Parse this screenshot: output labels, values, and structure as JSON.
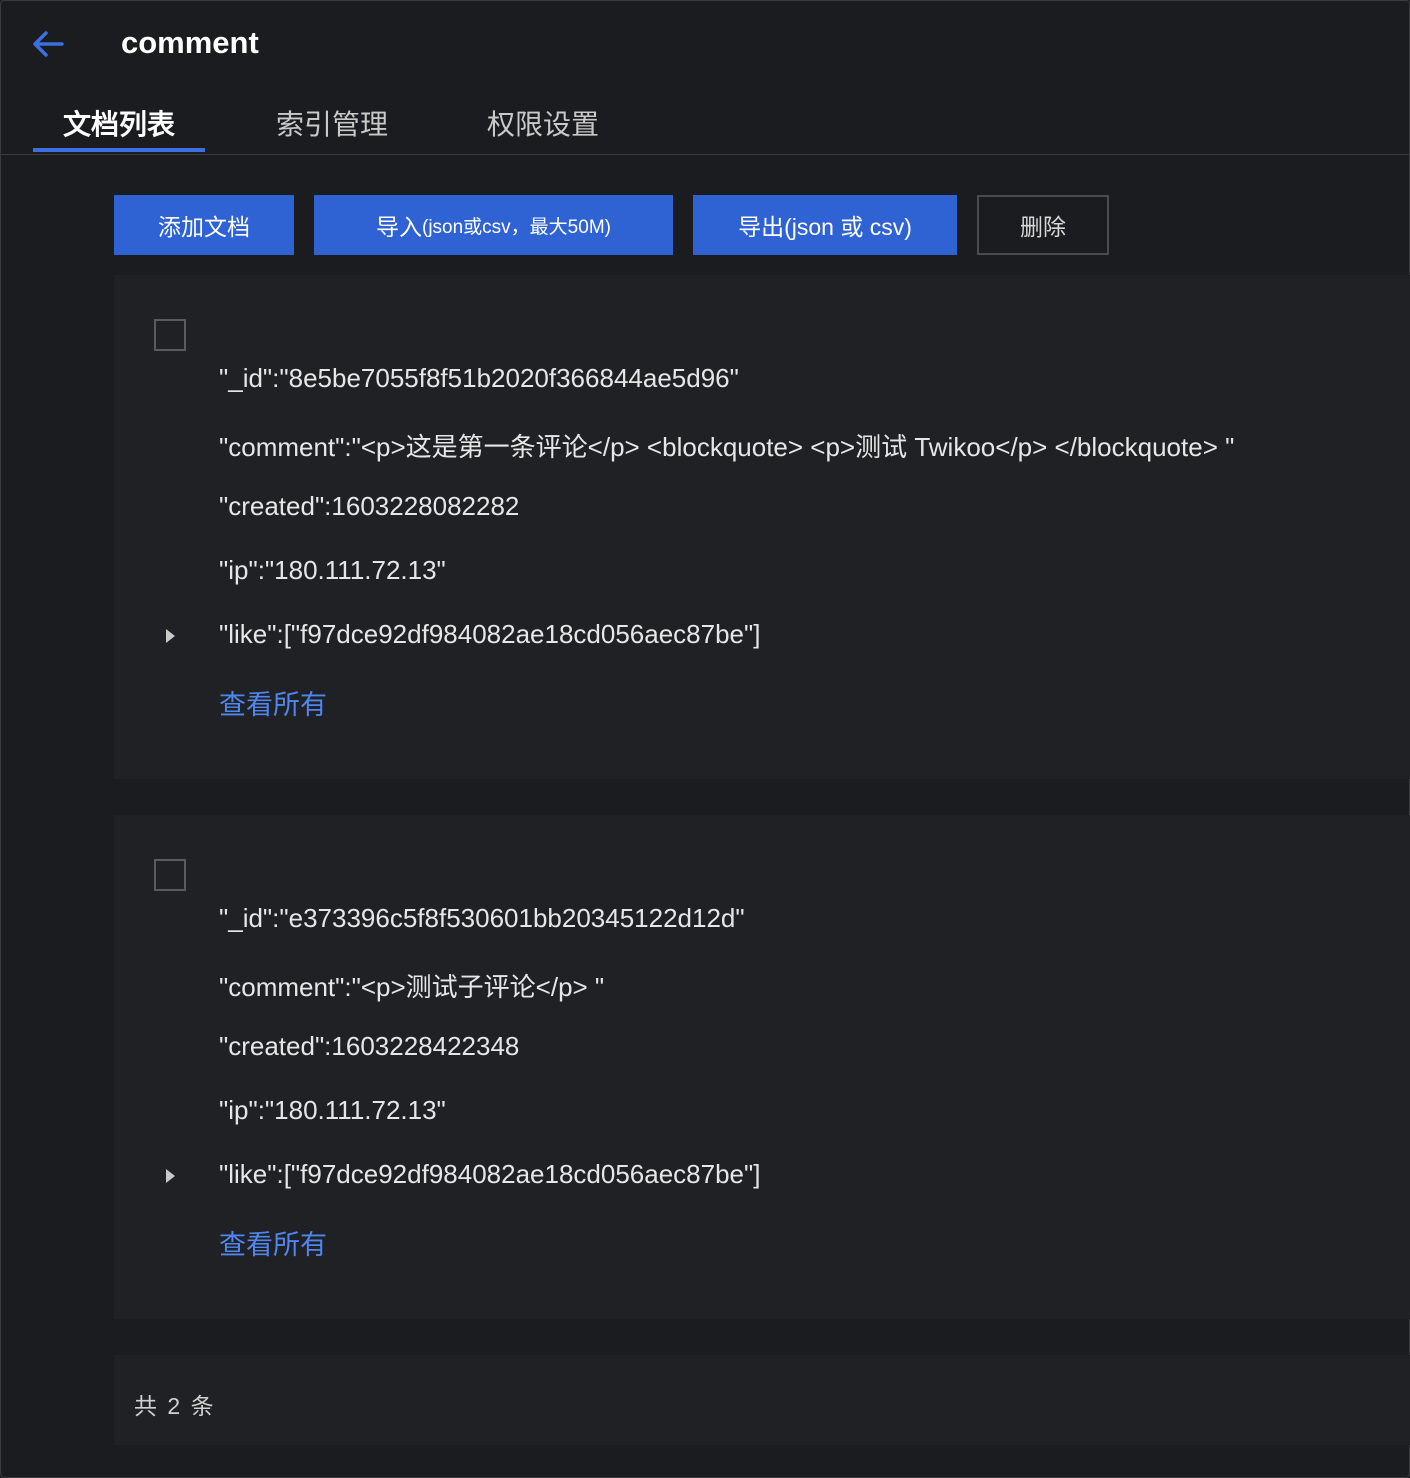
{
  "header": {
    "title": "comment",
    "back_icon": "arrow-left-icon",
    "accent": "#3c6fe0"
  },
  "tabs": [
    {
      "label": "文档列表",
      "active": true
    },
    {
      "label": "索引管理",
      "active": false
    },
    {
      "label": "权限设置",
      "active": false
    }
  ],
  "toolbar": {
    "add_label": "添加文档",
    "import_label": "导入",
    "import_note": "(json或csv，最大50M)",
    "export_label": "导出(json 或 csv)",
    "delete_label": "删除"
  },
  "documents": [
    {
      "id": "\"_id\":\"8e5be7055f8f51b2020f366844ae5d96\"",
      "comment": "\"comment\":\"<p>这是第一条评论</p> <blockquote> <p>测试 Twikoo</p> </blockquote> \"",
      "created": "\"created\":1603228082282",
      "ip": "\"ip\":\"180.111.72.13\"",
      "like": "\"like\":[\"f97dce92df984082ae18cd056aec87be\"]",
      "view_all": "查看所有"
    },
    {
      "id": "\"_id\":\"e373396c5f8f530601bb20345122d12d\"",
      "comment": "\"comment\":\"<p>测试子评论</p> \"",
      "created": "\"created\":1603228422348",
      "ip": "\"ip\":\"180.111.72.13\"",
      "like": "\"like\":[\"f97dce92df984082ae18cd056aec87be\"]",
      "view_all": "查看所有"
    }
  ],
  "footer": {
    "total_text": "共 2 条"
  }
}
